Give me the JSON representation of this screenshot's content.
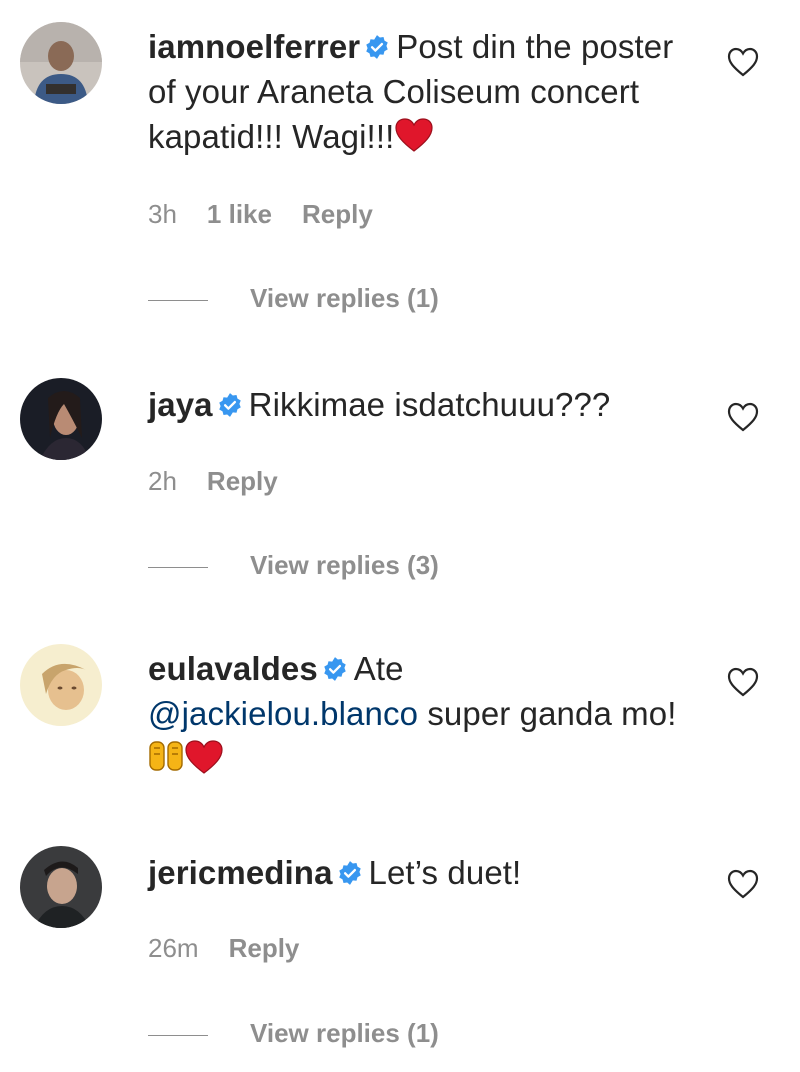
{
  "comments": [
    {
      "username": "iamnoelferrer",
      "text": "Post din the poster of your Araneta Coliseum concert kapatid!!! Wagi!!!",
      "emoji": "red-heart",
      "time": "3h",
      "likes": "1 like",
      "reply": "Reply",
      "view_replies": "View replies (1)"
    },
    {
      "username": "jaya",
      "text": "Rikkimae isdatchuuu???",
      "time": "2h",
      "reply": "Reply",
      "view_replies": "View replies (3)"
    },
    {
      "username": "eulavaldes",
      "text_before": "Ate",
      "mention": "@jackielou.blanco",
      "text_after": "super ganda mo!",
      "emojis": [
        "raising-hands",
        "red-heart"
      ]
    },
    {
      "username": "jericmedina",
      "text": "Let’s duet!",
      "time": "26m",
      "reply": "Reply",
      "view_replies": "View replies (1)"
    }
  ],
  "colors": {
    "text": "#262626",
    "meta": "#8e8e8e",
    "verified": "#3897f0",
    "mention": "#00376b",
    "heart_emoji": "#e0162b"
  },
  "icons": {
    "verified": "verified-badge-icon",
    "like": "heart-outline-icon"
  }
}
